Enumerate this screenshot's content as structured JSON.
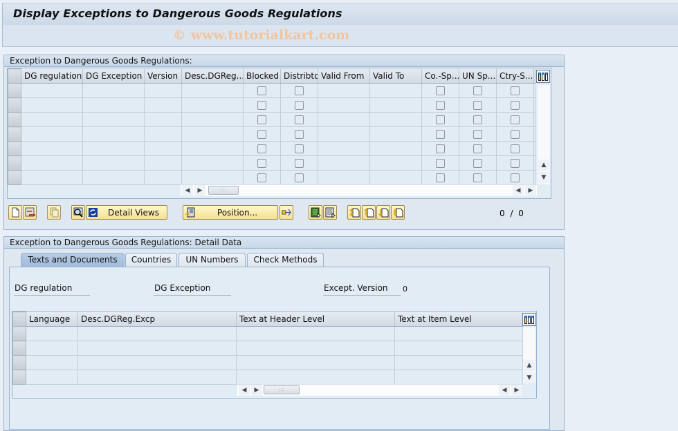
{
  "window": {
    "title": "Display Exceptions to Dangerous Goods Regulations",
    "watermark": "© www.tutorialkart.com"
  },
  "overview": {
    "group_title": "Exception to Dangerous Goods Regulations:",
    "columns": [
      "DG regulation",
      "DG Exception",
      "Version",
      "Desc.DGReg....",
      "Blocked",
      "Distribtd",
      "Valid From",
      "Valid To",
      "Co.-Sp...",
      "UN Sp...",
      "Ctry-S..."
    ],
    "checkbox_columns": [
      "Blocked",
      "Distribtd",
      "Co.-Sp...",
      "UN Sp...",
      "Ctry-S..."
    ],
    "rows": [
      {
        "dg_regulation": "",
        "dg_exception": "",
        "version": "",
        "desc": "",
        "blocked": false,
        "distributed": false,
        "valid_from": "",
        "valid_to": "",
        "co_sp": false,
        "un_sp": false,
        "ctry_s": false
      },
      {
        "dg_regulation": "",
        "dg_exception": "",
        "version": "",
        "desc": "",
        "blocked": false,
        "distributed": false,
        "valid_from": "",
        "valid_to": "",
        "co_sp": false,
        "un_sp": false,
        "ctry_s": false
      },
      {
        "dg_regulation": "",
        "dg_exception": "",
        "version": "",
        "desc": "",
        "blocked": false,
        "distributed": false,
        "valid_from": "",
        "valid_to": "",
        "co_sp": false,
        "un_sp": false,
        "ctry_s": false
      },
      {
        "dg_regulation": "",
        "dg_exception": "",
        "version": "",
        "desc": "",
        "blocked": false,
        "distributed": false,
        "valid_from": "",
        "valid_to": "",
        "co_sp": false,
        "un_sp": false,
        "ctry_s": false
      },
      {
        "dg_regulation": "",
        "dg_exception": "",
        "version": "",
        "desc": "",
        "blocked": false,
        "distributed": false,
        "valid_from": "",
        "valid_to": "",
        "co_sp": false,
        "un_sp": false,
        "ctry_s": false
      },
      {
        "dg_regulation": "",
        "dg_exception": "",
        "version": "",
        "desc": "",
        "blocked": false,
        "distributed": false,
        "valid_from": "",
        "valid_to": "",
        "co_sp": false,
        "un_sp": false,
        "ctry_s": false
      },
      {
        "dg_regulation": "",
        "dg_exception": "",
        "version": "",
        "desc": "",
        "blocked": false,
        "distributed": false,
        "valid_from": "",
        "valid_to": "",
        "co_sp": false,
        "un_sp": false,
        "ctry_s": false
      }
    ],
    "toolbar": {
      "detail_views_label": "Detail Views",
      "position_label": "Position...",
      "icons": [
        "new-entry-icon",
        "delete-entry-icon",
        "copy-icon",
        "choose-icon",
        "refresh-icon",
        "position-icon",
        "export-icon",
        "select-all-icon",
        "deselect-all-icon",
        "first-page-icon",
        "previous-page-icon",
        "next-page-icon",
        "last-page-icon"
      ]
    },
    "pager": "0 / 0"
  },
  "detail": {
    "group_title": "Exception to Dangerous Goods Regulations: Detail Data",
    "tabs": [
      {
        "label": "Texts and Documents",
        "active": true
      },
      {
        "label": "Countries",
        "active": false
      },
      {
        "label": "UN Numbers",
        "active": false
      },
      {
        "label": "Check Methods",
        "active": false
      }
    ],
    "fields": {
      "dg_regulation_label": "DG regulation",
      "dg_regulation_value": "",
      "dg_exception_label": "DG Exception",
      "dg_exception_value": "",
      "except_version_label": "Except. Version",
      "except_version_value": "0"
    },
    "texts_table": {
      "columns": [
        "Language",
        "Desc.DGReg.Excp",
        "Text at Header Level",
        "Text at Item Level"
      ],
      "rows": [
        {
          "language": "",
          "desc": "",
          "header_text": "",
          "item_text": ""
        },
        {
          "language": "",
          "desc": "",
          "header_text": "",
          "item_text": ""
        },
        {
          "language": "",
          "desc": "",
          "header_text": "",
          "item_text": ""
        },
        {
          "language": "",
          "desc": "",
          "header_text": "",
          "item_text": ""
        }
      ]
    }
  },
  "colors": {
    "background": "#e9eff7",
    "panel": "#dfe8f1",
    "button_yellow": "#f5e191",
    "active_tab": "#9fbadb",
    "watermark": "#f0c5a0"
  }
}
